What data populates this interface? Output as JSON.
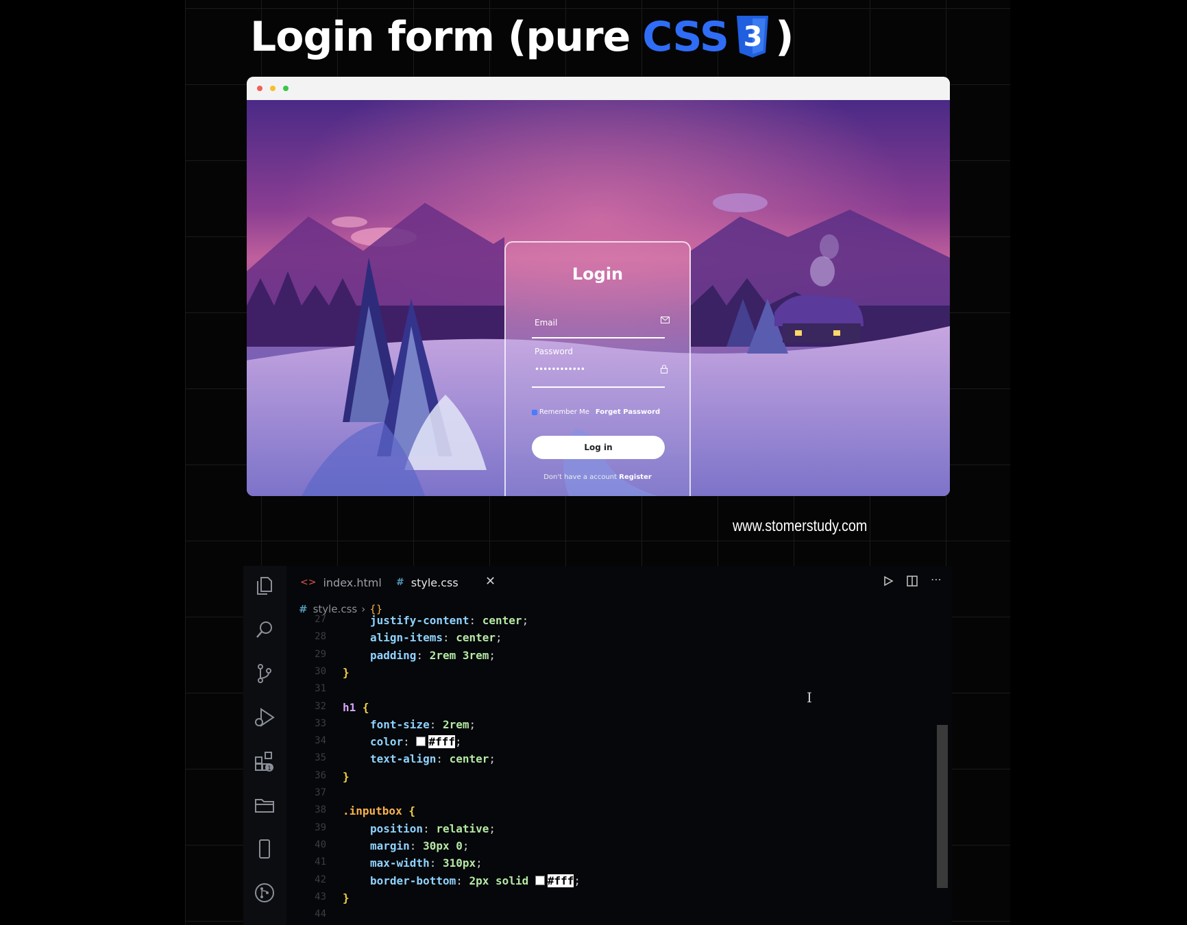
{
  "headline": {
    "prefix": "Login form (pure ",
    "css": "CSS",
    "css_badge": "3",
    "suffix": ")"
  },
  "browser": {
    "dots": [
      "red",
      "yellow",
      "green"
    ]
  },
  "login": {
    "title": "Login",
    "email_label": "Email",
    "password_label": "Password",
    "password_value": "••••••••••••",
    "remember_label": "Remember Me",
    "forgot_label": "Forget Password",
    "button_label": "Log in",
    "register_prompt": "Don't have a account",
    "register_link": "Register",
    "icons": {
      "email": "mail-icon",
      "password": "lock-icon"
    }
  },
  "site_url": "www.stomerstudy.com",
  "editor": {
    "tabs": [
      {
        "label": "index.html",
        "icon": "html-icon",
        "active": false
      },
      {
        "label": "style.css",
        "icon": "css-icon",
        "active": true
      }
    ],
    "breadcrumb": {
      "file": "style.css",
      "symbol": "{}"
    },
    "activity_icons": [
      "files-icon",
      "search-icon",
      "source-control-icon",
      "run-debug-icon",
      "extensions-icon",
      "folder-icon",
      "device-icon",
      "git-graph-icon"
    ],
    "extensions_badge": "1",
    "action_icons": [
      "run-icon",
      "split-editor-icon",
      "more-icon"
    ],
    "lines": [
      {
        "n": "27",
        "segments": [
          [
            "prop",
            "justify-content"
          ],
          [
            "punct",
            ": "
          ],
          [
            "val",
            "center"
          ],
          [
            "punct",
            ";"
          ]
        ],
        "indent": 1
      },
      {
        "n": "28",
        "segments": [
          [
            "prop",
            "align-items"
          ],
          [
            "punct",
            ": "
          ],
          [
            "val",
            "center"
          ],
          [
            "punct",
            ";"
          ]
        ],
        "indent": 1
      },
      {
        "n": "29",
        "segments": [
          [
            "prop",
            "padding"
          ],
          [
            "punct",
            ": "
          ],
          [
            "num",
            "2rem 3rem"
          ],
          [
            "punct",
            ";"
          ]
        ],
        "indent": 1
      },
      {
        "n": "30",
        "segments": [
          [
            "brace",
            "}"
          ]
        ],
        "indent": 0
      },
      {
        "n": "31",
        "segments": [],
        "indent": 0
      },
      {
        "n": "32",
        "segments": [
          [
            "sel",
            "h1"
          ],
          [
            "punct",
            " "
          ],
          [
            "brace",
            "{"
          ]
        ],
        "indent": 0
      },
      {
        "n": "33",
        "segments": [
          [
            "prop",
            "font-size"
          ],
          [
            "punct",
            ": "
          ],
          [
            "num",
            "2rem"
          ],
          [
            "punct",
            ";"
          ]
        ],
        "indent": 1
      },
      {
        "n": "34",
        "segments": [
          [
            "prop",
            "color"
          ],
          [
            "punct",
            ": "
          ],
          [
            "swatch",
            ""
          ],
          [
            "hexhl",
            "#fff"
          ],
          [
            "punct",
            ";"
          ]
        ],
        "indent": 1
      },
      {
        "n": "35",
        "segments": [
          [
            "prop",
            "text-align"
          ],
          [
            "punct",
            ": "
          ],
          [
            "val",
            "center"
          ],
          [
            "punct",
            ";"
          ]
        ],
        "indent": 1
      },
      {
        "n": "36",
        "segments": [
          [
            "brace",
            "}"
          ]
        ],
        "indent": 0
      },
      {
        "n": "37",
        "segments": [],
        "indent": 0
      },
      {
        "n": "38",
        "segments": [
          [
            "cls",
            ".inputbox"
          ],
          [
            "punct",
            " "
          ],
          [
            "brace",
            "{"
          ]
        ],
        "indent": 0
      },
      {
        "n": "39",
        "segments": [
          [
            "prop",
            "position"
          ],
          [
            "punct",
            ": "
          ],
          [
            "val",
            "relative"
          ],
          [
            "punct",
            ";"
          ]
        ],
        "indent": 1
      },
      {
        "n": "40",
        "segments": [
          [
            "prop",
            "margin"
          ],
          [
            "punct",
            ": "
          ],
          [
            "num",
            "30px 0"
          ],
          [
            "punct",
            ";"
          ]
        ],
        "indent": 1
      },
      {
        "n": "41",
        "segments": [
          [
            "prop",
            "max-width"
          ],
          [
            "punct",
            ": "
          ],
          [
            "num",
            "310px"
          ],
          [
            "punct",
            ";"
          ]
        ],
        "indent": 1
      },
      {
        "n": "42",
        "segments": [
          [
            "prop",
            "border-bottom"
          ],
          [
            "punct",
            ": "
          ],
          [
            "num",
            "2px"
          ],
          [
            "punct",
            " "
          ],
          [
            "val",
            "solid"
          ],
          [
            "punct",
            " "
          ],
          [
            "swatch",
            ""
          ],
          [
            "hexhl",
            "#fff"
          ],
          [
            "punct",
            ";"
          ]
        ],
        "indent": 1
      },
      {
        "n": "43",
        "segments": [
          [
            "brace",
            "}"
          ]
        ],
        "indent": 0
      },
      {
        "n": "44",
        "segments": [],
        "indent": 0
      }
    ]
  },
  "colors": {
    "css_blue": "#2f6df6",
    "background": "#050505",
    "editor_bg": "#06070a"
  }
}
